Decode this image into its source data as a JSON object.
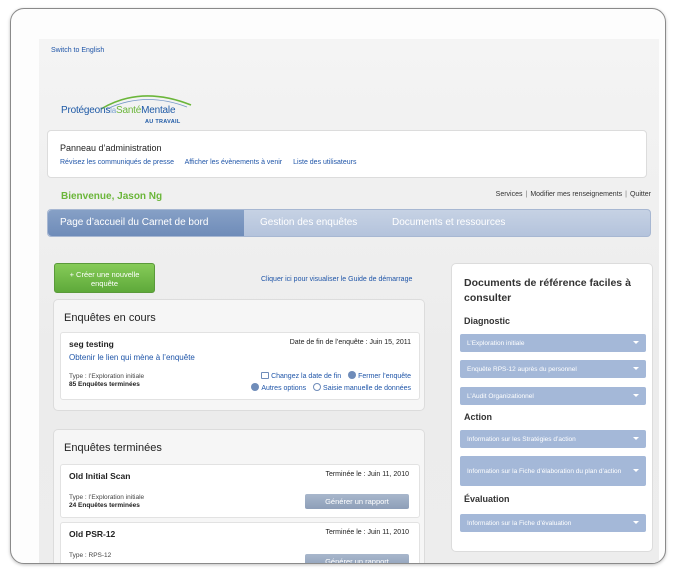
{
  "switch_language": "Switch to English",
  "logo": {
    "part1": "Protégeons",
    "part2": "la",
    "part3": "Santé",
    "part4": "Mentale",
    "sub": "AU TRAVAIL"
  },
  "admin": {
    "title": "Panneau d’administration",
    "links": [
      "Révisez les communiqués de presse",
      "Afficher les évènements à venir",
      "Liste des utilisateurs"
    ]
  },
  "welcome": "Bienvenue, Jason Ng",
  "user_links": [
    "Services",
    "Modifier mes renseignements",
    "Quitter"
  ],
  "nav": {
    "tabs": [
      "Page d’accueil du Carnet de bord",
      "Gestion des enquêtes",
      "Documents et ressources"
    ]
  },
  "create_button": {
    "line1": "+ Créer une nouvelle",
    "line2": "enquête"
  },
  "guide_link": "Cliquer ici pour visualiser le Guide de démarrage",
  "current_surveys": {
    "title": "Enquêtes en cours",
    "items": [
      {
        "name": "seg testing",
        "end_date": "Date de fin de l’enquête : Juin 15, 2011",
        "link": "Obtenir le lien qui mène à l’enquête",
        "type": "Type : l’Exploration initiale",
        "count": "85 Enquêtes terminées",
        "actions": [
          "Changez la date de fin",
          "Fermer l’enquête",
          "Autres options",
          "Saisie manuelle de données"
        ]
      }
    ]
  },
  "completed_surveys": {
    "title": "Enquêtes terminées",
    "items": [
      {
        "name": "Old Initial Scan",
        "date": "Terminée le : Juin 11, 2010",
        "type": "Type : l’Exploration initiale",
        "count": "24 Enquêtes terminées",
        "button": "Générer un rapport"
      },
      {
        "name": "Old PSR-12",
        "date": "Terminée le : Juin 11, 2010",
        "type": "Type : RPS-12",
        "count": "",
        "button": "Générer un rapport"
      }
    ]
  },
  "sidebar": {
    "title": "Documents de référence faciles à consulter",
    "sections": [
      {
        "heading": "Diagnostic",
        "items": [
          "L’Exploration initiale",
          "Enquête RPS-12 auprès du personnel",
          "L’Audit Organizationnel"
        ]
      },
      {
        "heading": "Action",
        "items": [
          "Information sur les Stratégies d’action",
          "Information sur la Fiche d’élaboration du plan d’action"
        ]
      },
      {
        "heading": "Évaluation",
        "items": [
          "Information sur la Fiche d’évaluation"
        ]
      }
    ]
  },
  "colors": {
    "link": "#1f55a8",
    "brand_green": "#6bb63a",
    "nav_bar": "#b4c3dc",
    "nav_active": "#6f8cb9",
    "pill": "#a4b8d8",
    "generate_button": "#8d9eb8"
  }
}
